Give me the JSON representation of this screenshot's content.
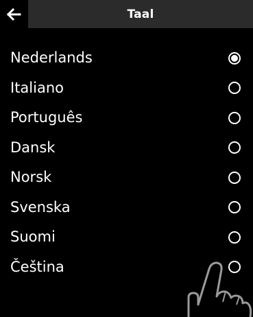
{
  "header": {
    "back_icon": "arrow-left-icon",
    "title": "Taal",
    "title_bar_color": "#2b2b2b"
  },
  "languages": [
    {
      "label": "Nederlands",
      "selected": true
    },
    {
      "label": "Italiano",
      "selected": false
    },
    {
      "label": "Português",
      "selected": false
    },
    {
      "label": "Dansk",
      "selected": false
    },
    {
      "label": "Norsk",
      "selected": false
    },
    {
      "label": "Svenska",
      "selected": false
    },
    {
      "label": "Suomi",
      "selected": false
    },
    {
      "label": "Čeština",
      "selected": false
    }
  ],
  "overlay": {
    "icon": "tap-hand-icon"
  },
  "colors": {
    "background": "#000000",
    "text": "#ffffff",
    "hand_outline": "#9a9a9a"
  }
}
